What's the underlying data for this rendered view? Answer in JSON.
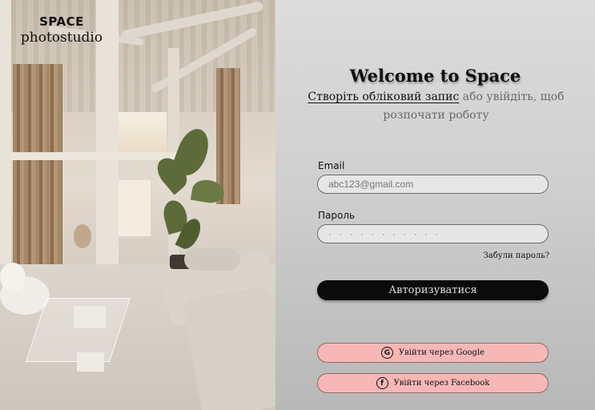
{
  "brand": {
    "name": "SPACE",
    "subtitle": "photostudio"
  },
  "heading": "Welcome to Space",
  "intro": {
    "link": "Створіть обліковий запис",
    "text": " або увійдіть, щоб розпочати роботу"
  },
  "email": {
    "label": "Email",
    "placeholder": "abc123@gmail.com"
  },
  "password": {
    "label": "Пароль",
    "value": "· · · · · · · · · · ·"
  },
  "forgot": "Забули пароль?",
  "login_button": "Авторизуватися",
  "google": {
    "label": "Увійти через Google",
    "icon": "google-icon",
    "glyph": "G"
  },
  "facebook": {
    "label": "Увійти через Facebook",
    "icon": "facebook-icon",
    "glyph": "f"
  },
  "colors": {
    "primary_button": "#0b0b0b",
    "social_button": "#f7b7b7"
  }
}
